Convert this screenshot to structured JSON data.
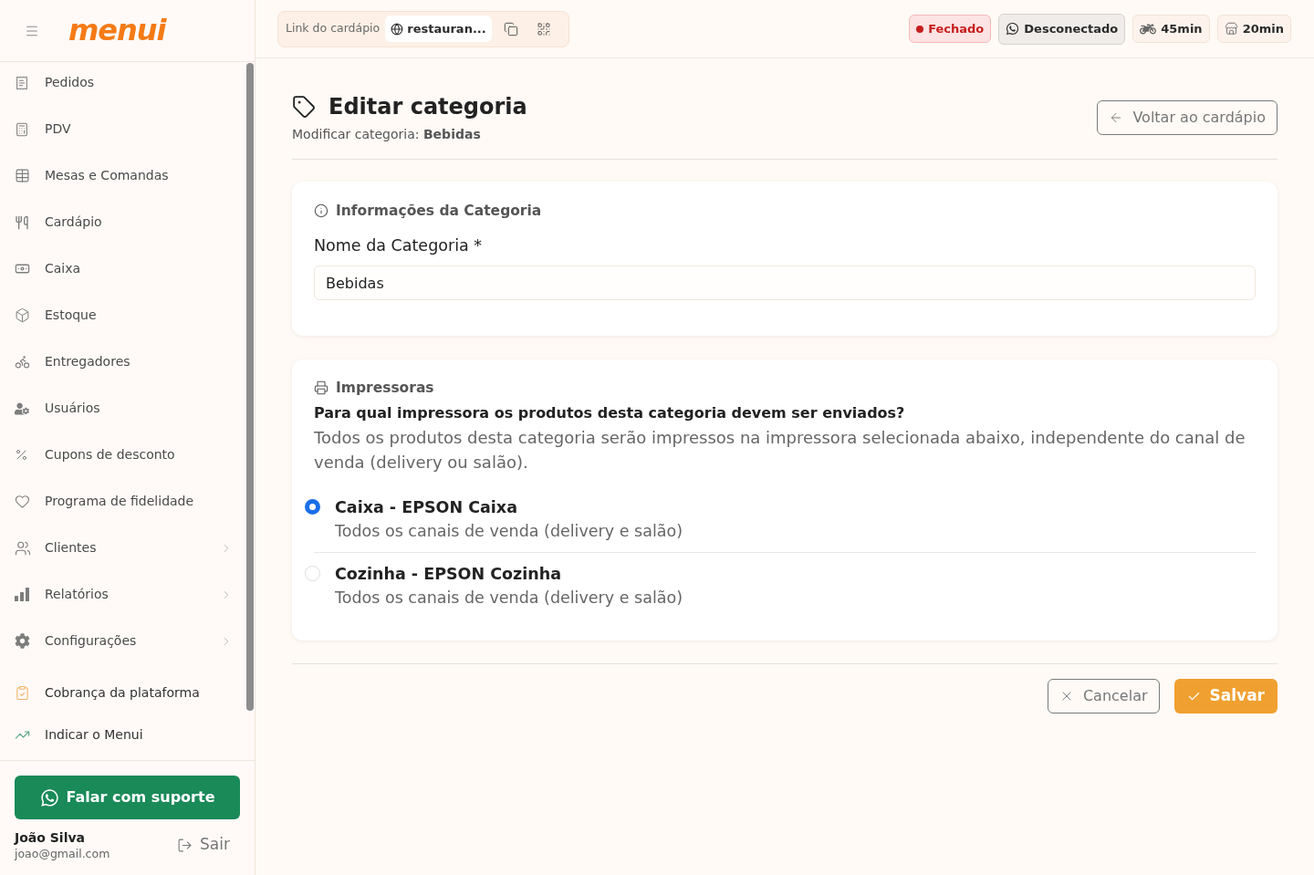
{
  "sidebar": {
    "logo": "menui",
    "menu_items": [
      {
        "label": "Pedidos",
        "has_submenu": false
      },
      {
        "label": "PDV",
        "has_submenu": false
      },
      {
        "label": "Mesas e Comandas",
        "has_submenu": false
      },
      {
        "label": "Cardápio",
        "has_submenu": false
      },
      {
        "label": "Caixa",
        "has_submenu": false
      },
      {
        "label": "Estoque",
        "has_submenu": false
      },
      {
        "label": "Entregadores",
        "has_submenu": false
      },
      {
        "label": "Usuários",
        "has_submenu": false
      },
      {
        "label": "Cupons de desconto",
        "has_submenu": false
      },
      {
        "label": "Programa de fidelidade",
        "has_submenu": false
      },
      {
        "label": "Clientes",
        "has_submenu": true
      },
      {
        "label": "Relatórios",
        "has_submenu": true
      },
      {
        "label": "Configurações",
        "has_submenu": true
      }
    ],
    "extra_items": [
      {
        "label": "Cobrança da plataforma"
      },
      {
        "label": "Indicar o Menui"
      }
    ],
    "support_button": "Falar com suporte",
    "user": {
      "name": "João Silva",
      "email": "joao@gmail.com"
    },
    "logout_button": "Sair"
  },
  "topbar": {
    "menu_link": {
      "label": "Link do cardápio",
      "link_preview": "restauran..."
    },
    "badges": [
      {
        "kind": "status",
        "label": "Fechado"
      },
      {
        "kind": "whatsapp",
        "label": "Desconectado"
      },
      {
        "kind": "delivery_time",
        "label": "45min"
      },
      {
        "kind": "pickup_time",
        "label": "20min"
      }
    ]
  },
  "page": {
    "title": "Editar categoria",
    "subtitle": "Modificar categoria: **Bebidas**",
    "back_button": "Voltar ao cardápio"
  },
  "info_card": {
    "title": "Informações da Categoria",
    "field": {
      "label": "Nome da Categoria *",
      "value": "Bebidas"
    }
  },
  "printers_card": {
    "title": "Impressoras",
    "question": "Para qual impressora os produtos desta categoria devem ser enviados?",
    "description": "Todos os produtos desta categoria serão impressos na impressora selecionada abaixo, independente do canal de venda (delivery ou salão).",
    "options": [
      {
        "name": "Caixa - EPSON Caixa",
        "channels": "Todos os canais de venda (delivery e salão)",
        "selected": true
      },
      {
        "name": "Cozinha - EPSON Cozinha",
        "channels": "Todos os canais de venda (delivery e salão)",
        "selected": false
      }
    ]
  },
  "actions": {
    "cancel": "Cancelar",
    "save": "Salvar"
  }
}
